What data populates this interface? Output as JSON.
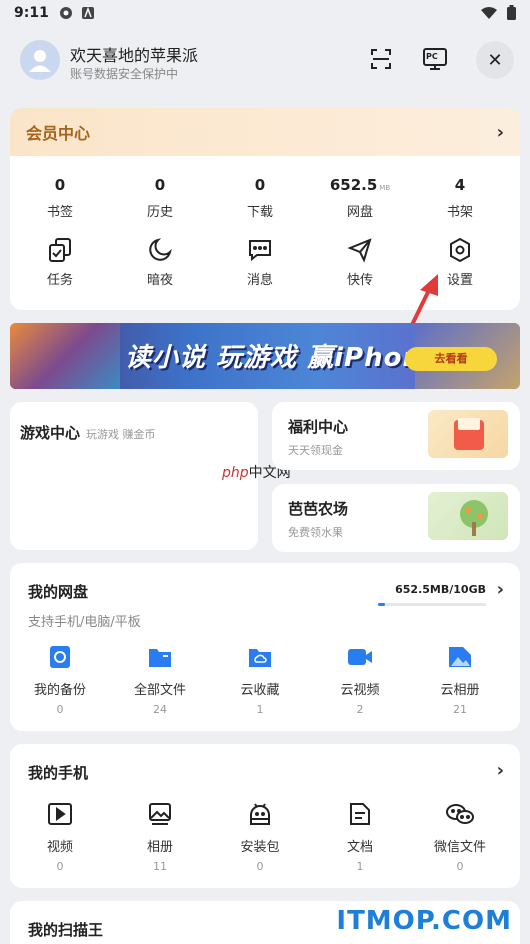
{
  "status": {
    "time": "9:11"
  },
  "header": {
    "username": "欢天喜地的苹果派",
    "subtitle": "账号数据安全保护中",
    "pc_label": "PC"
  },
  "member": {
    "title": "会员中心",
    "stats": [
      {
        "num": "0",
        "unit": "",
        "label": "书签"
      },
      {
        "num": "0",
        "unit": "",
        "label": "历史"
      },
      {
        "num": "0",
        "unit": "",
        "label": "下载"
      },
      {
        "num": "652.5",
        "unit": "MB",
        "label": "网盘"
      },
      {
        "num": "4",
        "unit": "",
        "label": "书架"
      }
    ],
    "tools": [
      {
        "icon": "task-icon",
        "label": "任务"
      },
      {
        "icon": "moon-icon",
        "label": "暗夜"
      },
      {
        "icon": "message-icon",
        "label": "消息"
      },
      {
        "icon": "send-icon",
        "label": "快传"
      },
      {
        "icon": "settings-icon",
        "label": "设置"
      }
    ]
  },
  "banner": {
    "title": "读小说 玩游戏 赢iPhone",
    "button": "去看看"
  },
  "game": {
    "title": "游戏中心",
    "subtitle": "玩游戏 赚金币"
  },
  "welfare": {
    "title": "福利中心",
    "subtitle": "天天领现金"
  },
  "farm": {
    "title": "芭芭农场",
    "subtitle": "免费领水果"
  },
  "watermark": {
    "php": "php",
    "cn": "中文网"
  },
  "cloud": {
    "title": "我的网盘",
    "subtitle": "支持手机/电脑/平板",
    "quota": "652.5MB/10GB",
    "usage_fraction": 0.064,
    "items": [
      {
        "label": "我的备份",
        "count": "0"
      },
      {
        "label": "全部文件",
        "count": "24"
      },
      {
        "label": "云收藏",
        "count": "1"
      },
      {
        "label": "云视频",
        "count": "2"
      },
      {
        "label": "云相册",
        "count": "21"
      }
    ]
  },
  "phone": {
    "title": "我的手机",
    "items": [
      {
        "label": "视频",
        "count": "0"
      },
      {
        "label": "相册",
        "count": "11"
      },
      {
        "label": "安装包",
        "count": "0"
      },
      {
        "label": "文档",
        "count": "1"
      },
      {
        "label": "微信文件",
        "count": "0"
      }
    ]
  },
  "scanner": {
    "title": "我的扫描王"
  },
  "site_logo": "ITMOP.COM"
}
